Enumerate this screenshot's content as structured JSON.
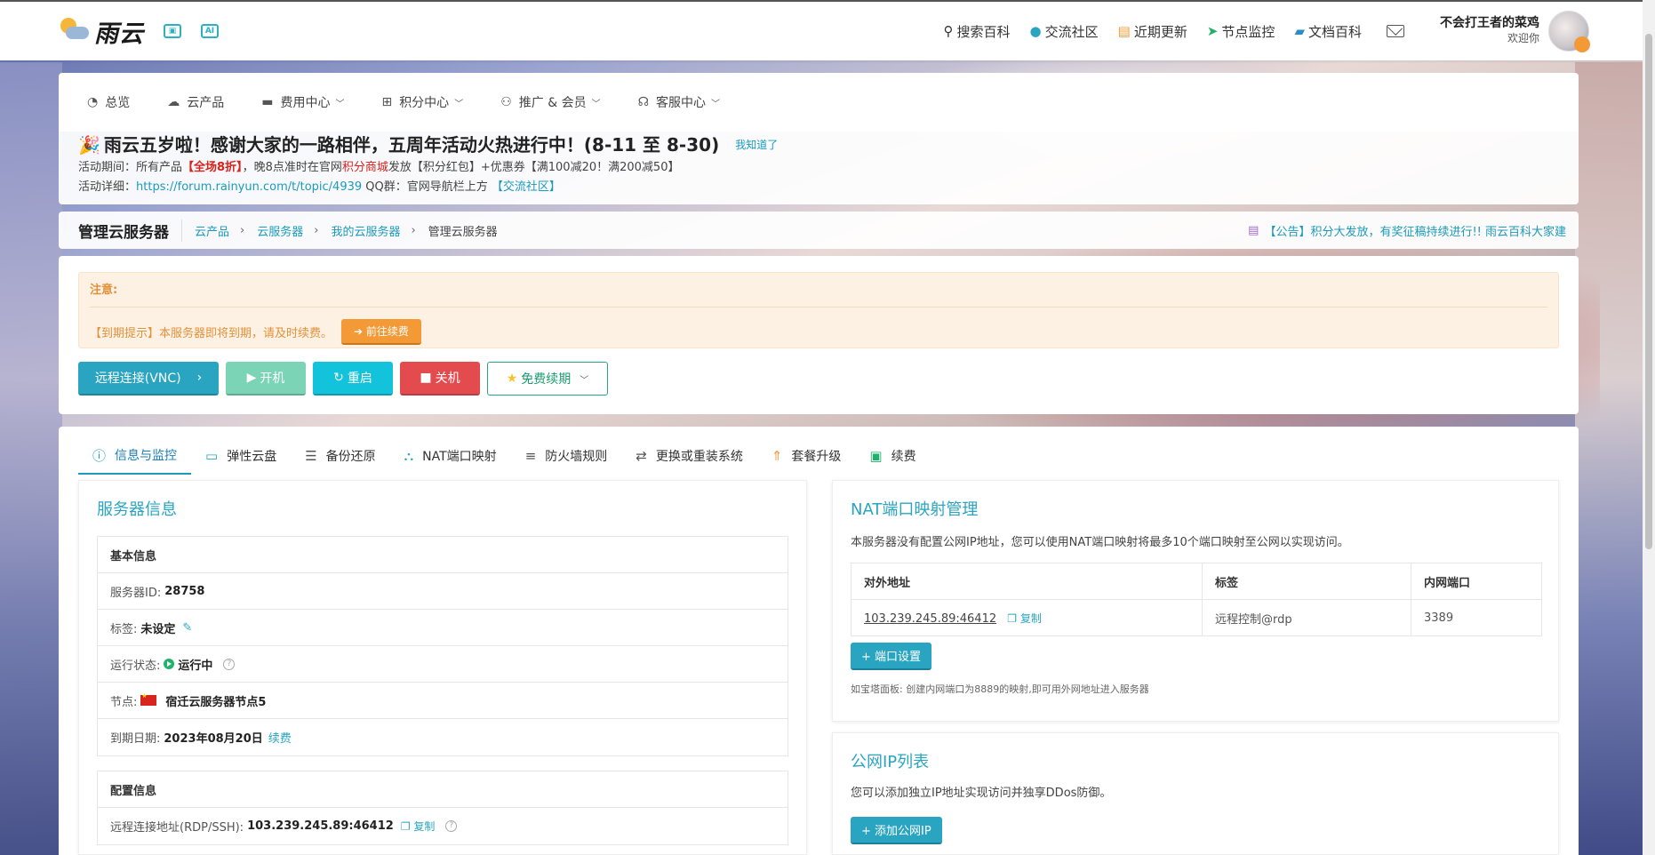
{
  "brand": {
    "name": "雨云",
    "icon_a": "AI"
  },
  "topnav": [
    {
      "icon": "search-icon",
      "glyph": "🔍",
      "label": "搜索百科"
    },
    {
      "icon": "community-icon",
      "glyph": "●",
      "label": "交流社区"
    },
    {
      "icon": "updates-icon",
      "glyph": "▤",
      "label": "近期更新"
    },
    {
      "icon": "monitor-icon",
      "glyph": "➤",
      "label": "节点监控"
    },
    {
      "icon": "docs-icon",
      "glyph": "📖",
      "label": "文档百科"
    }
  ],
  "user": {
    "name": "不会打王者的菜鸡",
    "greeting": "欢迎你"
  },
  "mainnav": [
    {
      "icon": "dashboard-icon",
      "label": "总览",
      "dropdown": false
    },
    {
      "icon": "cloud-products-icon",
      "label": "云产品",
      "dropdown": false
    },
    {
      "icon": "billing-icon",
      "label": "费用中心",
      "dropdown": true
    },
    {
      "icon": "points-icon",
      "label": "积分中心",
      "dropdown": true
    },
    {
      "icon": "promo-icon",
      "label": "推广 & 会员",
      "dropdown": true
    },
    {
      "icon": "support-icon",
      "label": "客服中心",
      "dropdown": true
    }
  ],
  "announcement": {
    "title": "雨云五岁啦！感谢大家的一路相伴，五周年活动火热进行中！(8-11 至 8-30)",
    "dismiss": "我知道了",
    "line1_a": "活动期间：所有产品",
    "line1_red": "【全场8折】",
    "line1_b": "，晚8点准时在官网",
    "line1_red2": "积分商城",
    "line1_c": "发放【积分红包】+优惠券【满100减20！满200减50】",
    "line2_a": "活动详细：",
    "line2_link": "https://forum.rainyun.com/t/topic/4939",
    "line2_b": " QQ群：官网导航栏上方 ",
    "line2_link2": "【交流社区】"
  },
  "breadcrumb": {
    "title": "管理云服务器",
    "items": [
      "云产品",
      "云服务器",
      "我的云服务器",
      "管理云服务器"
    ],
    "notice": "【公告】积分大发放，有奖征稿持续进行!! 雨云百科大家建"
  },
  "alert": {
    "heading": "注意:",
    "message": "【到期提示】本服务器即将到期，请及时续费。",
    "renew_button": "➔ 前往续费"
  },
  "actions": {
    "vnc": "远程连接(VNC)",
    "start": "开机",
    "restart": "重启",
    "shutdown": "关机",
    "free_renew": "免费续期"
  },
  "tabs": [
    {
      "icon": "info-icon",
      "glyph": "ⓘ",
      "label": "信息与监控",
      "active": true
    },
    {
      "icon": "disk-icon",
      "glyph": "▭",
      "label": "弹性云盘",
      "active": false
    },
    {
      "icon": "backup-icon",
      "glyph": "☰",
      "label": "备份还原",
      "active": false
    },
    {
      "icon": "nat-icon",
      "glyph": "⛬",
      "label": "NAT端口映射",
      "active": false
    },
    {
      "icon": "firewall-icon",
      "glyph": "≡",
      "label": "防火墙规则",
      "active": false
    },
    {
      "icon": "reinstall-icon",
      "glyph": "⇄",
      "label": "更换或重装系统",
      "active": false
    },
    {
      "icon": "upgrade-icon",
      "glyph": "⇑",
      "label": "套餐升级",
      "active": false
    },
    {
      "icon": "renew-icon",
      "glyph": "▣",
      "label": "续费",
      "active": false
    }
  ],
  "server_info": {
    "card_title": "服务器信息",
    "basic_heading": "基本信息",
    "id_label": "服务器ID:",
    "id_value": "28758",
    "tag_label": "标签:",
    "tag_value": "未设定",
    "status_label": "运行状态:",
    "status_value": "运行中",
    "node_label": "节点:",
    "node_value": "宿迁云服务器节点5",
    "expiry_label": "到期日期:",
    "expiry_value": "2023年08月20日",
    "expiry_link": "续费",
    "config_heading": "配置信息",
    "remote_label": "远程连接地址(RDP/SSH):",
    "remote_value": "103.239.245.89:46412",
    "copy": "复制"
  },
  "nat": {
    "title": "NAT端口映射管理",
    "desc": "本服务器没有配置公网IP地址，您可以使用NAT端口映射将最多10个端口映射至公网以实现访问。",
    "columns": [
      "对外地址",
      "标签",
      "内网端口"
    ],
    "row": {
      "addr": "103.239.245.89:46412",
      "copy": "复制",
      "tag": "远程控制@rdp",
      "port": "3389"
    },
    "port_button": "+ 端口设置",
    "tip": "如宝塔面板: 创建内网端口为8889的映射,即可用外网地址进入服务器"
  },
  "public_ip": {
    "title": "公网IP列表",
    "desc": "您可以添加独立IP地址实现访问并独享DDos防御。",
    "button": "+ 添加公网IP"
  }
}
